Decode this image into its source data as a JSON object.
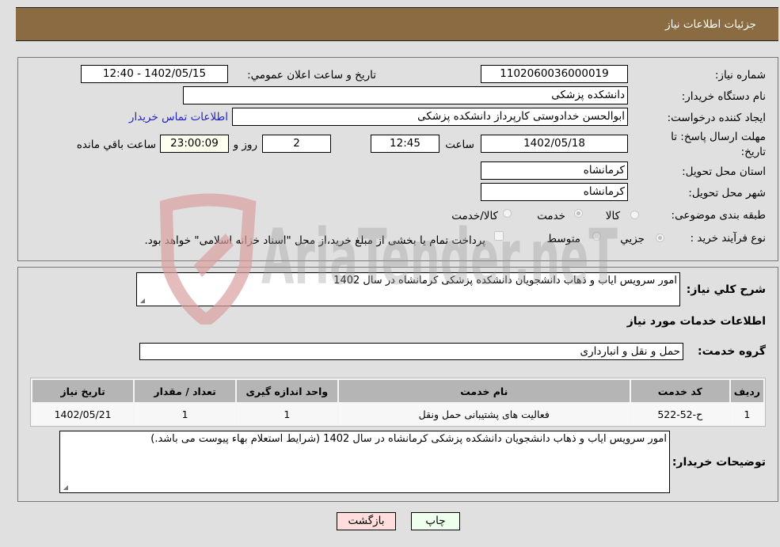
{
  "header": {
    "title": "جزئيات اطلاعات نياز"
  },
  "form": {
    "need_number": {
      "label": "شماره نیاز:",
      "value": "1102060036000019"
    },
    "announce_datetime": {
      "label": "تاريخ و ساعت اعلان عمومي:",
      "value": "1402/05/15 - 12:40"
    },
    "buyer_org": {
      "label": "نام دستگاه خريدار:",
      "value": "دانشکده پزشکی"
    },
    "requester": {
      "label": "ایجاد کننده درخواست:",
      "value": "ابوالحسن خدادوستی کارپرداز دانشکده پزشکی"
    },
    "buyer_contact_link": "اطلاعات تماس خريدار",
    "deadline": {
      "label_line1": "مهلت ارسال پاسخ: تا",
      "label_line2": "تاریخ:",
      "date": "1402/05/18",
      "time_label": "ساعت",
      "time": "12:45",
      "days": "2",
      "days_label": "روز و",
      "remaining": "23:00:09",
      "remaining_label": "ساعت باقي مانده"
    },
    "province": {
      "label": "استان محل تحویل:",
      "value": "کرمانشاه"
    },
    "city": {
      "label": "شهر محل تحویل:",
      "value": "کرمانشاه"
    },
    "category": {
      "label": "طبقه بندی موضوعی:",
      "options": [
        {
          "label": "کالا",
          "selected": false
        },
        {
          "label": "خدمت",
          "selected": true
        },
        {
          "label": "کالا/خدمت",
          "selected": false
        }
      ]
    },
    "purchase_type": {
      "label": "نوع فرآیند خرید :",
      "options": [
        {
          "label": "جزيي",
          "selected": true
        },
        {
          "label": "متوسط",
          "selected": false
        }
      ],
      "treasury_note": "پرداخت تمام یا بخشی از مبلغ خرید،از محل \"اسناد خزانه اسلامی\" خواهد بود.",
      "treasury_checked": false
    }
  },
  "details": {
    "summary_label": "شرح کلي نياز:",
    "summary_value": "امور سرویس  ایاب و ذهاب دانشجویان دانشکده پزشکی کرمانشاه در سال 1402",
    "services_title": "اطلاعات خدمات مورد نياز",
    "service_group_label": "گروه خدمت:",
    "service_group_value": "حمل و نقل و انبارداری",
    "table": {
      "headers": [
        "رديف",
        "کد خدمت",
        "نام خدمت",
        "واحد اندازه گيری",
        "تعداد / مقدار",
        "تاريخ نياز"
      ],
      "rows": [
        [
          "1",
          "ح-52-522",
          "فعالیت های پشتیبانی حمل ونقل",
          "1",
          "1",
          "1402/05/21"
        ]
      ]
    },
    "buyer_notes_label": "توضيحات خريدار:",
    "buyer_notes_value": "امور سرویس  ایاب و ذهاب دانشجویان دانشکده پزشکی کرمانشاه در سال 1402 (شرایط استعلام بهاء پیوست می باشد.)"
  },
  "buttons": {
    "print": "چاپ",
    "back": "بازگشت"
  },
  "colors": {
    "header_bg": "#8b6b41",
    "print_bg": "#eeffee",
    "back_bg": "#ffdddd",
    "link": "#2222cc"
  },
  "watermark": "AriaTender.neT"
}
